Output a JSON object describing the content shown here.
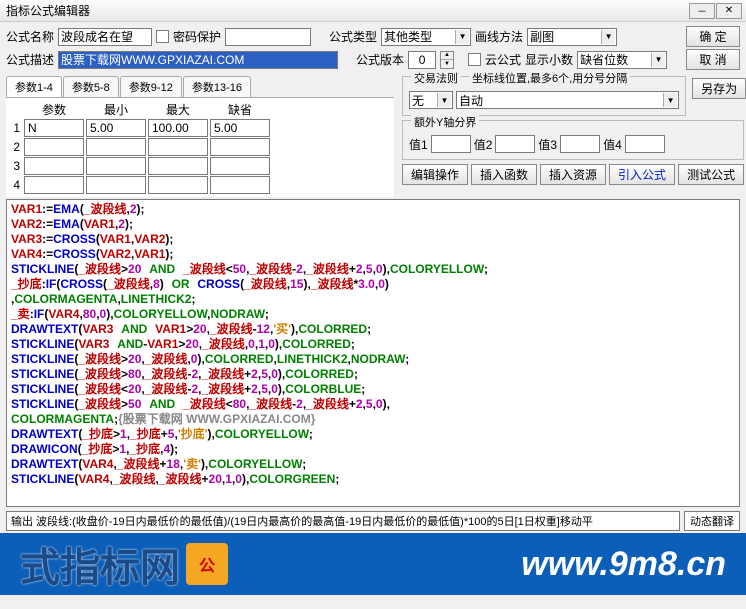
{
  "window": {
    "title": "指标公式编辑器"
  },
  "row1": {
    "name_label": "公式名称",
    "name_value": "波段成名在望",
    "pwd_label": "密码保护",
    "type_label": "公式类型",
    "type_value": "其他类型",
    "draw_label": "画线方法",
    "draw_value": "副图",
    "ok": "确 定"
  },
  "row2": {
    "desc_label": "公式描述",
    "desc_value": "股票下载网WWW.GPXIAZAI.COM",
    "ver_label": "公式版本",
    "ver_value": "0",
    "cloud_label": "云公式",
    "digits_label": "显示小数",
    "digits_value": "缺省位数",
    "cancel": "取 消"
  },
  "tabs": [
    "参数1-4",
    "参数5-8",
    "参数9-12",
    "参数13-16"
  ],
  "param_hdr": [
    "参数",
    "最小",
    "最大",
    "缺省"
  ],
  "param_rows": [
    {
      "n": "1",
      "p": "N",
      "min": "5.00",
      "max": "100.00",
      "def": "5.00"
    },
    {
      "n": "2",
      "p": "",
      "min": "",
      "max": "",
      "def": ""
    },
    {
      "n": "3",
      "p": "",
      "min": "",
      "max": "",
      "def": ""
    },
    {
      "n": "4",
      "p": "",
      "min": "",
      "max": "",
      "def": ""
    }
  ],
  "trade": {
    "title": "交易法则",
    "hint": "坐标线位置,最多6个,用分号分隔",
    "sel1": "无",
    "sel2": "自动",
    "saveas": "另存为"
  },
  "yaxis": {
    "title": "额外Y轴分界",
    "v1": "值1",
    "v2": "值2",
    "v3": "值3",
    "v4": "值4"
  },
  "toolbar": {
    "edit": "编辑操作",
    "insfn": "插入函数",
    "insres": "插入资源",
    "importf": "引入公式",
    "test": "测试公式"
  },
  "status": {
    "text": "输出 波段线:(收盘价-19日内最低价的最低值)/(19日内最高价的最高值-19日内最低价的最低值)*100的5日[1日权重]移动平",
    "auto": "动态翻译"
  },
  "banner": {
    "left": "式指标网",
    "url": "www.9m8.cn"
  }
}
